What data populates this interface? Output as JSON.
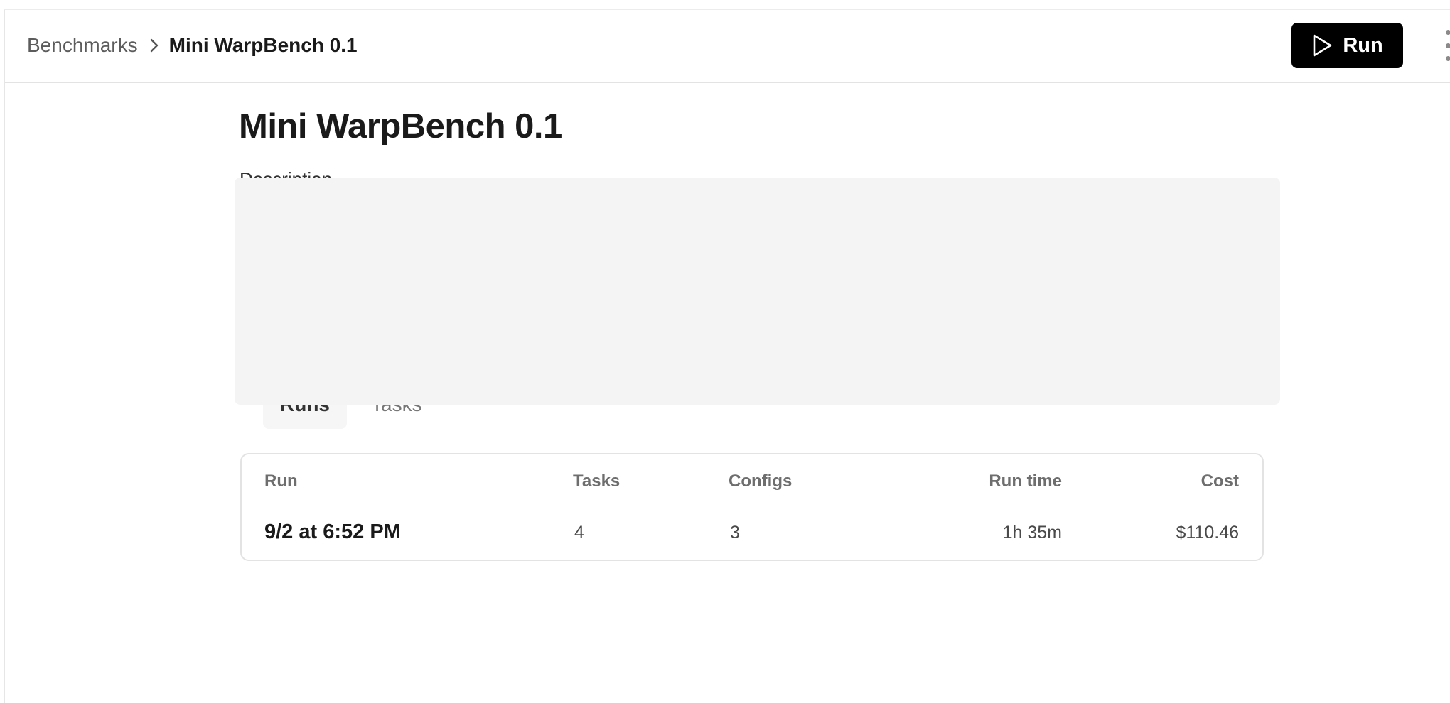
{
  "breadcrumb": {
    "root_label": "Benchmarks",
    "current_label": "Mini WarpBench 0.1"
  },
  "toolbar": {
    "run_label": "Run",
    "run_icon": "play-icon",
    "more_icon": "more-vertical-icon"
  },
  "page": {
    "title": "Mini WarpBench 0.1",
    "description_label": "Description"
  },
  "tabs": [
    {
      "label": "Runs",
      "active": true
    },
    {
      "label": "Tasks",
      "active": false
    }
  ],
  "table": {
    "headers": {
      "run": "Run",
      "tasks": "Tasks",
      "configs": "Configs",
      "run_time": "Run time",
      "cost": "Cost"
    },
    "rows": [
      {
        "run": "9/2 at 6:52 PM",
        "tasks": "4",
        "configs": "3",
        "run_time": "1h 35m",
        "cost": "$110.46"
      }
    ]
  },
  "colors": {
    "run_button_bg": "#000000",
    "overlay_panel": "#f4f4f4",
    "border": "#e3e3e3"
  }
}
